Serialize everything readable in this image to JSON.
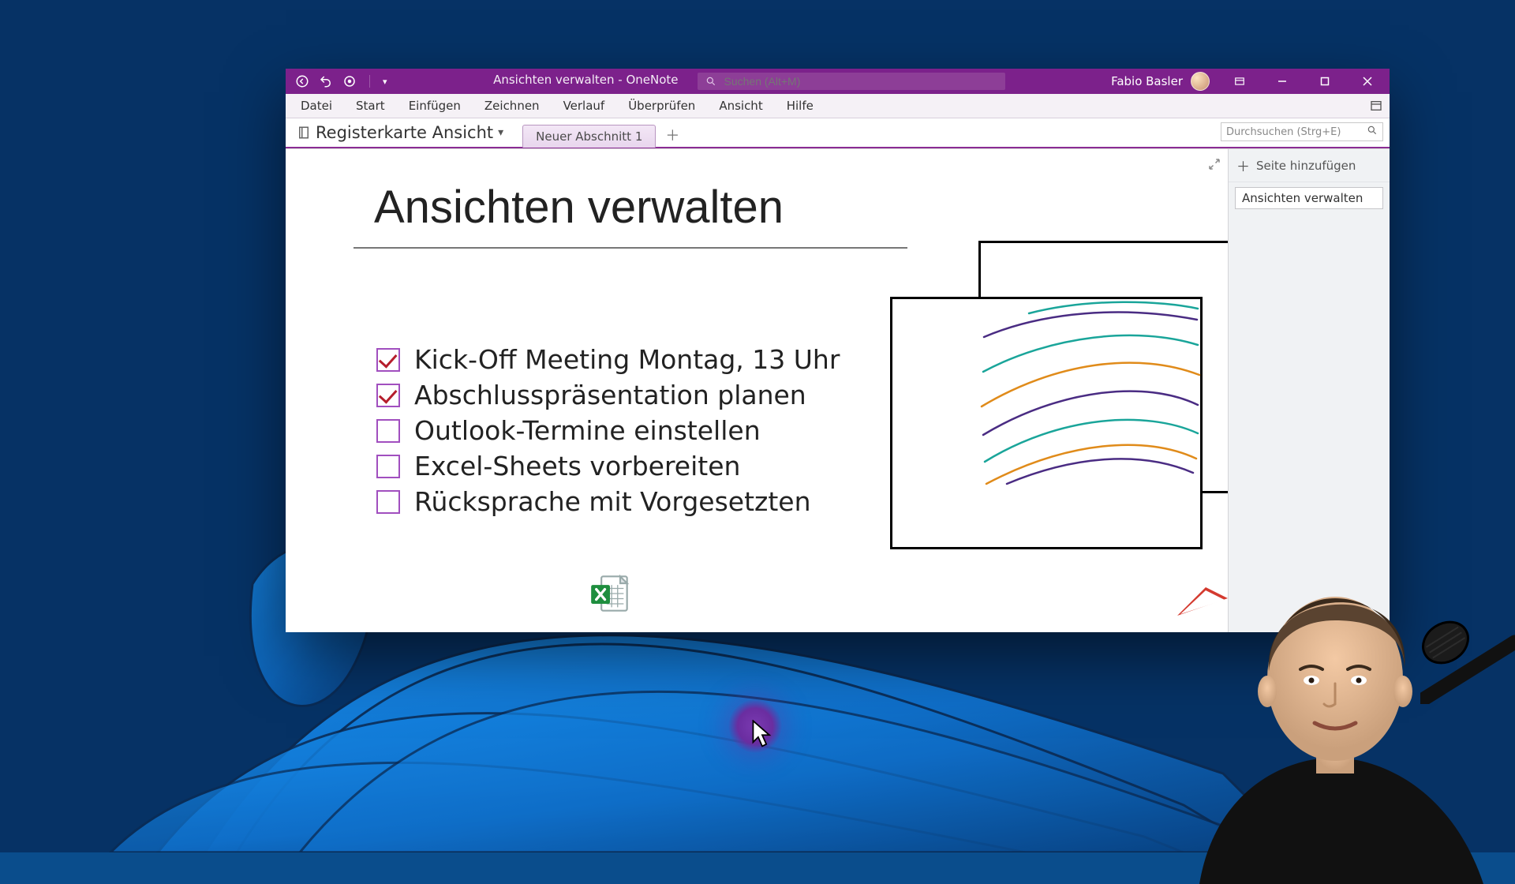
{
  "window": {
    "title": "Ansichten verwalten  -  OneNote",
    "user_name": "Fabio Basler"
  },
  "search": {
    "placeholder": "Suchen (Alt+M)"
  },
  "ribbon": {
    "tabs": [
      "Datei",
      "Start",
      "Einfügen",
      "Zeichnen",
      "Verlauf",
      "Überprüfen",
      "Ansicht",
      "Hilfe"
    ]
  },
  "notebook": {
    "name": "Registerkarte Ansicht",
    "section_tab": "Neuer Abschnitt 1"
  },
  "page_search": {
    "placeholder": "Durchsuchen (Strg+E)"
  },
  "page": {
    "title": "Ansichten verwalten",
    "todos": [
      {
        "checked": true,
        "text": "Kick-Off Meeting Montag, 13 Uhr"
      },
      {
        "checked": true,
        "text": "Abschlusspräsentation planen"
      },
      {
        "checked": false,
        "text": "Outlook-Termine einstellen"
      },
      {
        "checked": false,
        "text": "Excel-Sheets vorbereiten"
      },
      {
        "checked": false,
        "text": "Rücksprache mit Vorgesetzten"
      }
    ]
  },
  "pages_panel": {
    "add_label": "Seite hinzufügen",
    "entries": [
      "Ansichten verwalten"
    ]
  },
  "colors": {
    "brand_purple": "#7c218b",
    "accent_purple": "#8d3e97",
    "checkbox_border": "#a14fbf",
    "check_color": "#b51e2c",
    "excel_green": "#1e8e3e"
  }
}
